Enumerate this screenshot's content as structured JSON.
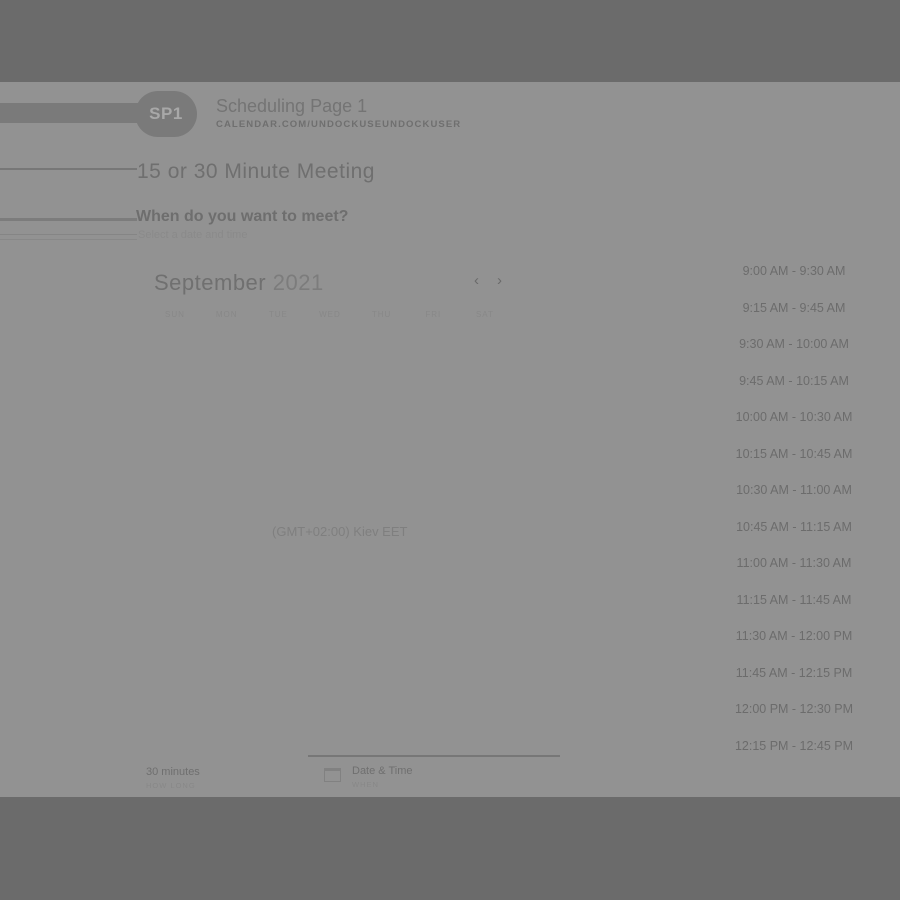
{
  "header": {
    "avatar_initials": "SP1",
    "page_name": "Scheduling Page 1",
    "page_url": "CALENDAR.COM/UNDOCKUSEUNDOCKUSER"
  },
  "meeting": {
    "title": "15 or 30 Minute Meeting",
    "question": "When do you want to meet?",
    "subtitle": "Select a date and time"
  },
  "calendar": {
    "month": "September",
    "year": "2021",
    "prev_icon": "chevron-left-icon",
    "next_icon": "chevron-right-icon",
    "weekdays": [
      "SUN",
      "MON",
      "TUE",
      "WED",
      "THU",
      "FRI",
      "SAT"
    ]
  },
  "timezone": "(GMT+02:00) Kiev EET",
  "time_slots": [
    "9:00 AM - 9:30 AM",
    "9:15 AM - 9:45 AM",
    "9:30 AM - 10:00 AM",
    "9:45 AM - 10:15 AM",
    "10:00 AM - 10:30 AM",
    "10:15 AM - 10:45 AM",
    "10:30 AM - 11:00 AM",
    "10:45 AM - 11:15 AM",
    "11:00 AM - 11:30 AM",
    "11:15 AM - 11:45 AM",
    "11:30 AM - 12:00 PM",
    "11:45 AM - 12:15 PM",
    "12:00 PM - 12:30 PM",
    "12:15 PM - 12:45 PM"
  ],
  "footer": {
    "duration": "30 minutes",
    "duration_sub": "HOW LONG",
    "datetime": "Date & Time",
    "datetime_sub": "WHEN",
    "datetime_icon": "calendar-icon"
  }
}
